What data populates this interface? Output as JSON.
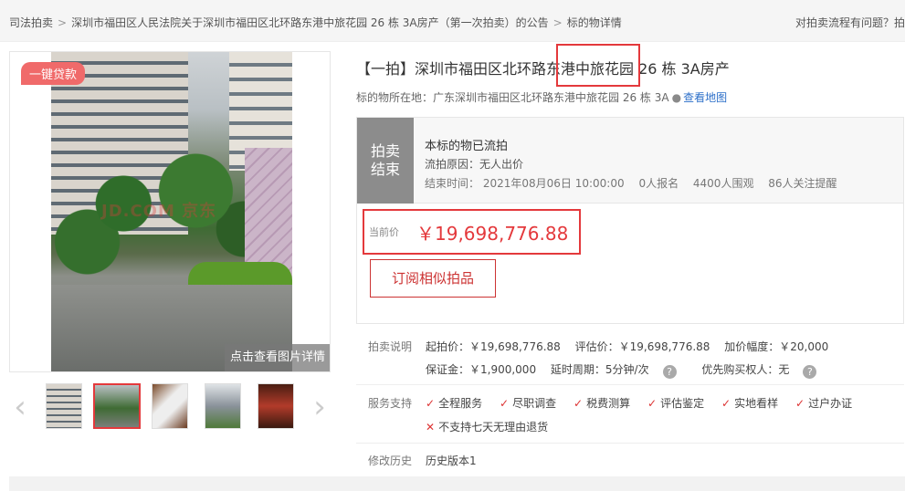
{
  "breadcrumb": {
    "items": [
      "司法拍卖",
      "深圳市福田区人民法院关于深圳市福田区北环路东港中旅花园 26 栋 3A房产（第一次拍卖）的公告",
      "标的物详情"
    ],
    "separator": ">"
  },
  "help_link": "对拍卖流程有问题？拍",
  "gallery": {
    "badge": "一键贷款",
    "watermark": "JD.COM 京东",
    "view_details": "点击查看图片详情",
    "prev_arrow": "‹",
    "next_arrow": "›"
  },
  "listing": {
    "title": "【一拍】深圳市福田区北环路东港中旅花园 26 栋 3A房产",
    "location_label": "标的物所在地：",
    "location_value": "广东深圳市福田区北环路东港中旅花园 26 栋 3A",
    "view_map": "查看地图"
  },
  "status": {
    "tag_line1": "拍卖",
    "tag_line2": "结束",
    "main": "本标的物已流拍",
    "reason": "流拍原因：无人出价",
    "end_time": "结束时间： 2021年08月06日 10:00:00",
    "signups": "0人报名",
    "views": "4400人围观",
    "watchers": "86人关注提醒"
  },
  "price": {
    "label": "当前价",
    "value": "￥19,698,776.88",
    "subscribe": "订阅相似拍品"
  },
  "auction_info": {
    "label": "拍卖说明",
    "start_price": "起拍价：￥19,698,776.88",
    "appraisal": "评估价：￥19,698,776.88",
    "increment": "加价幅度：￥20,000",
    "deposit": "保证金：￥1,900,000",
    "delay": "延时周期：5分钟/次",
    "priority": "优先购买权人：无",
    "help_glyph": "?"
  },
  "services": {
    "label": "服务支持",
    "items": [
      "全程服务",
      "尽职调查",
      "税费测算",
      "评估鉴定",
      "实地看样",
      "过户办证"
    ],
    "no_return": "不支持七天无理由退货"
  },
  "history": {
    "label": "修改历史",
    "value": "历史版本1"
  },
  "colors": {
    "accent": "#e4393c",
    "link": "#2c6fc9",
    "badge": "#f06a6a",
    "status_tag": "#8c8c8c"
  }
}
